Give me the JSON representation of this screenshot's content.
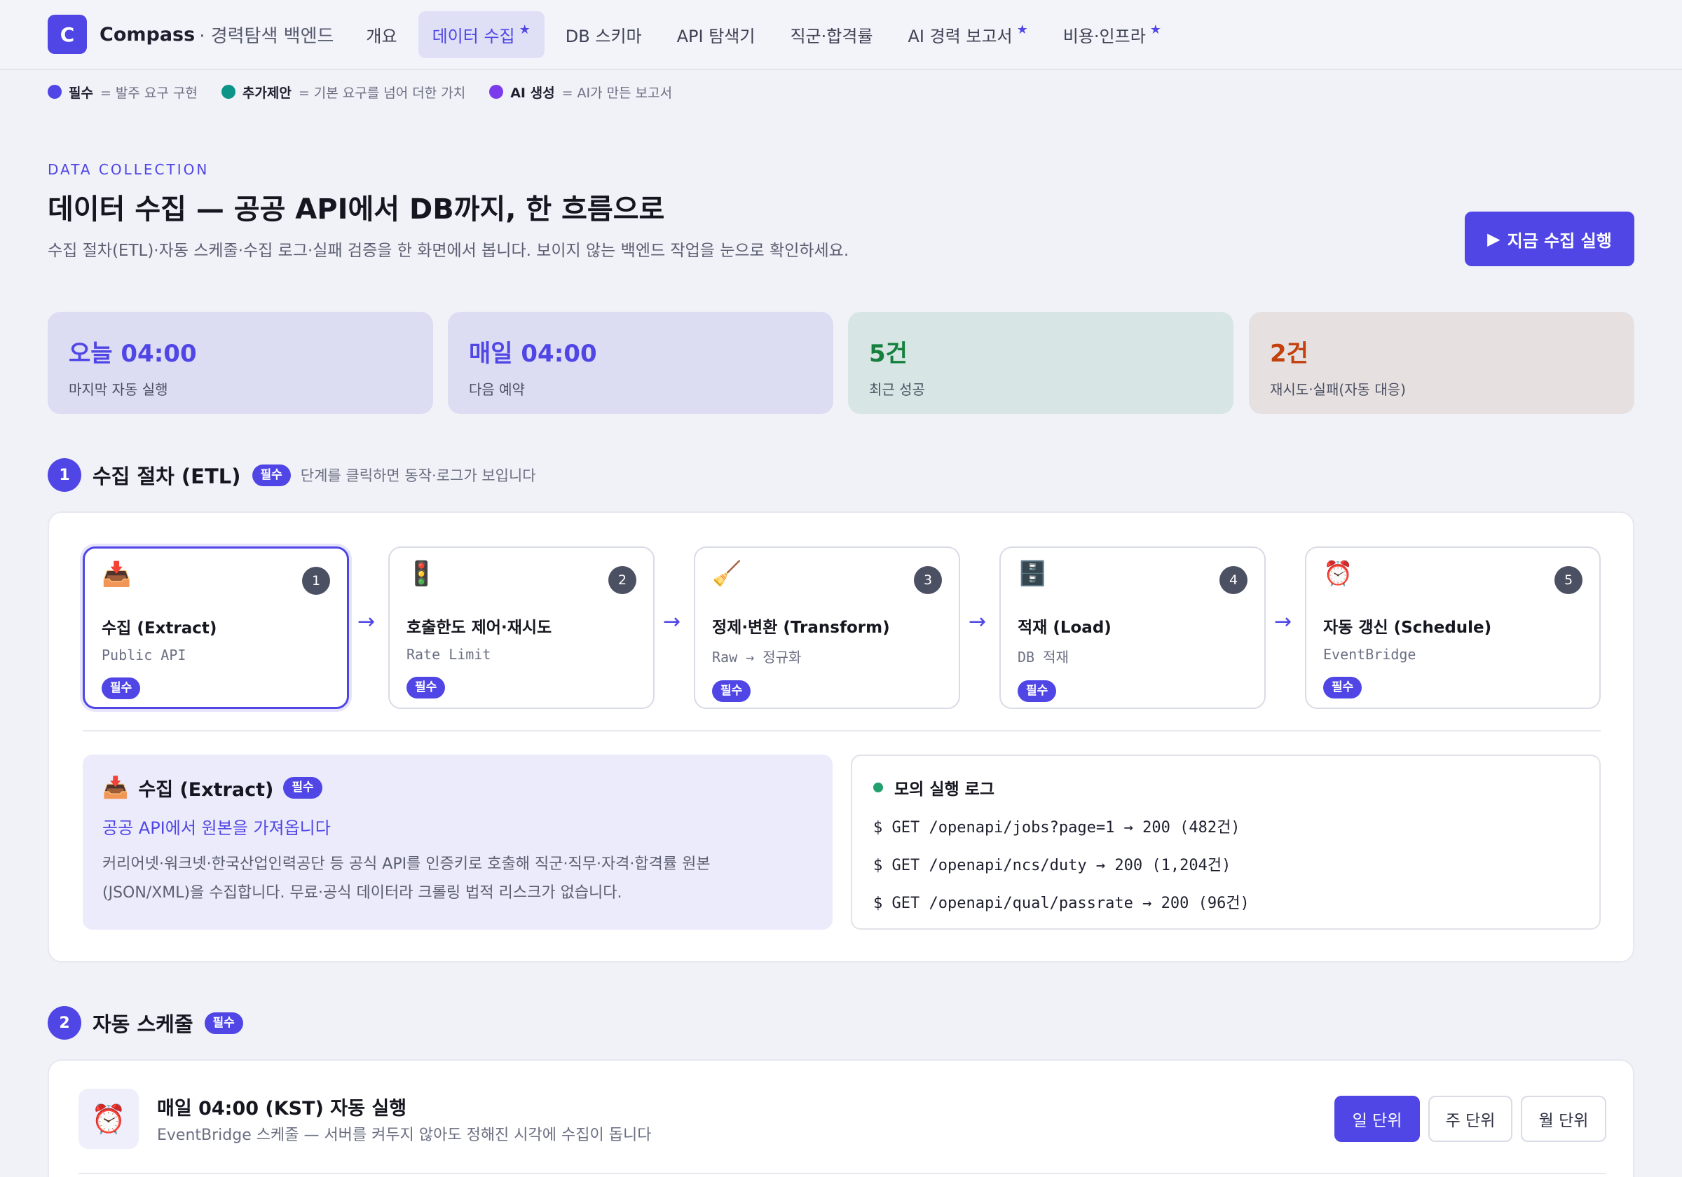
{
  "app": {
    "logo_letter": "C",
    "brand": "Compass",
    "brand_sub": "· 경력탐색 백엔드"
  },
  "nav": {
    "items": [
      {
        "label": "개요",
        "star": ""
      },
      {
        "label": "데이터 수집",
        "star": "★"
      },
      {
        "label": "DB 스키마",
        "star": ""
      },
      {
        "label": "API 탐색기",
        "star": ""
      },
      {
        "label": "직군·합격률",
        "star": ""
      },
      {
        "label": "AI 경력 보고서",
        "star": "★"
      },
      {
        "label": "비용·인프라",
        "star": "★"
      }
    ],
    "active_index": 1
  },
  "legend": [
    {
      "label": "필수",
      "desc": "= 발주 요구 구현",
      "color": "#4f46e5"
    },
    {
      "label": "추가제안",
      "desc": "= 기본 요구를 넘어 더한 가치",
      "color": "#0d9488"
    },
    {
      "label": "AI 생성",
      "desc": "= AI가 만든 보고서",
      "color": "#7c3aed"
    }
  ],
  "hero": {
    "eyebrow": "DATA COLLECTION",
    "title": "데이터 수집 — 공공 API에서 DB까지, 한 흐름으로",
    "lead": "수집 절차(ETL)·자동 스케줄·수집 로그·실패 검증을 한 화면에서 봅니다. 보이지 않는 백엔드 작업을 눈으로 확인하세요.",
    "run_button": "지금 수집 실행",
    "run_icon": "▶"
  },
  "stats": [
    {
      "value": "오늘 04:00",
      "label": "마지막 자동 실행",
      "bg": "#dcdcf3",
      "color": "#4f46e5"
    },
    {
      "value": "매일 04:00",
      "label": "다음 예약",
      "bg": "#dcdcf3",
      "color": "#4f46e5"
    },
    {
      "value": "5건",
      "label": "최근 성공",
      "bg": "#d7e6e4",
      "color": "#15803d"
    },
    {
      "value": "2건",
      "label": "재시도·실패(자동 대응)",
      "bg": "#e7e0e0",
      "color": "#c2410c"
    }
  ],
  "section1": {
    "num": "1",
    "title": "수집 절차 (ETL)",
    "badge": "필수",
    "hint": "단계를 클릭하면 동작·로그가 보입니다"
  },
  "steps": [
    {
      "icon": "📥",
      "num": "1",
      "title": "수집 (Extract)",
      "sub": "Public API",
      "badge": "필수"
    },
    {
      "icon": "🚦",
      "num": "2",
      "title": "호출한도 제어·재시도",
      "sub": "Rate Limit",
      "badge": "필수"
    },
    {
      "icon": "🧹",
      "num": "3",
      "title": "정제·변환 (Transform)",
      "sub": "Raw → 정규화",
      "badge": "필수"
    },
    {
      "icon": "🗄️",
      "num": "4",
      "title": "적재 (Load)",
      "sub": "DB 적재",
      "badge": "필수"
    },
    {
      "icon": "⏰",
      "num": "5",
      "title": "자동 갱신 (Schedule)",
      "sub": "EventBridge",
      "badge": "필수"
    }
  ],
  "arrow": "→",
  "detail": {
    "icon": "📥",
    "title": "수집 (Extract)",
    "badge": "필수",
    "subtitle": "공공 API에서 원본을 가져옵니다",
    "body_line1": "커리어넷·워크넷·한국산업인력공단 등 공식 API를 인증키로 호출해 직군·직무·자격·합격률 원본",
    "body_line2": "(JSON/XML)을 수집합니다. 무료·공식 데이터라 크롤링 법적 리스크가 없습니다."
  },
  "log": {
    "title": "모의 실행 로그",
    "status_color": "#22a06b",
    "lines": [
      "$ GET /openapi/jobs?page=1 → 200 (482건)",
      "$ GET /openapi/ncs/duty → 200 (1,204건)",
      "$ GET /openapi/qual/passrate → 200 (96건)"
    ]
  },
  "section2": {
    "num": "2",
    "title": "자동 스케줄",
    "badge": "필수"
  },
  "schedule": {
    "icon": "⏰",
    "title": "매일 04:00 (KST) 자동 실행",
    "sub": "EventBridge 스케줄 — 서버를 켜두지 않아도 정해진 시각에 수집이 돕니다",
    "options": [
      "일 단위",
      "주 단위",
      "월 단위"
    ],
    "selected_index": 0
  }
}
